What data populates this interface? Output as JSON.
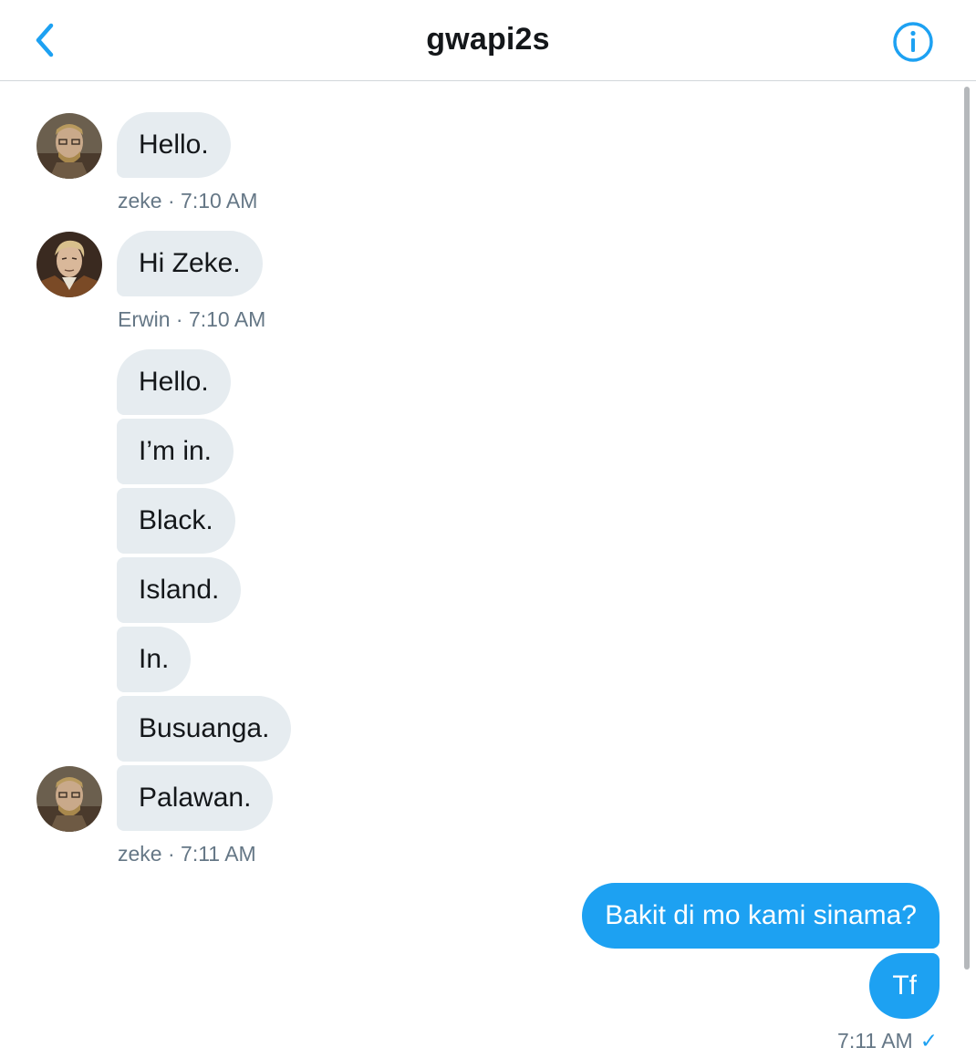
{
  "header": {
    "title": "gwapi2s",
    "back_icon": "chevron-left-icon",
    "info_icon": "info-circle-icon"
  },
  "colors": {
    "accent": "#1da1f2",
    "incoming_bubble": "#e6ecf0",
    "meta_text": "#657786"
  },
  "messages": [
    {
      "direction": "in",
      "text": "Hello.",
      "avatar": "avatar-zeke"
    },
    {
      "direction": "in",
      "text": "Hi Zeke.",
      "avatar": "avatar-erwin"
    },
    {
      "direction": "in",
      "text": "Hello."
    },
    {
      "direction": "in",
      "text": "I’m in."
    },
    {
      "direction": "in",
      "text": "Black."
    },
    {
      "direction": "in",
      "text": "Island."
    },
    {
      "direction": "in",
      "text": "In."
    },
    {
      "direction": "in",
      "text": "Busuanga."
    },
    {
      "direction": "in",
      "text": "Palawan.",
      "avatar": "avatar-zeke"
    },
    {
      "direction": "out",
      "text": "Bakit di mo kami sinama?"
    },
    {
      "direction": "out",
      "text": "Tf"
    }
  ],
  "meta": {
    "m1": "zeke · 7:10 AM",
    "m2": "Erwin · 7:10 AM",
    "m3": "zeke · 7:11 AM",
    "out": "7:11 AM",
    "out_check": "✓"
  }
}
